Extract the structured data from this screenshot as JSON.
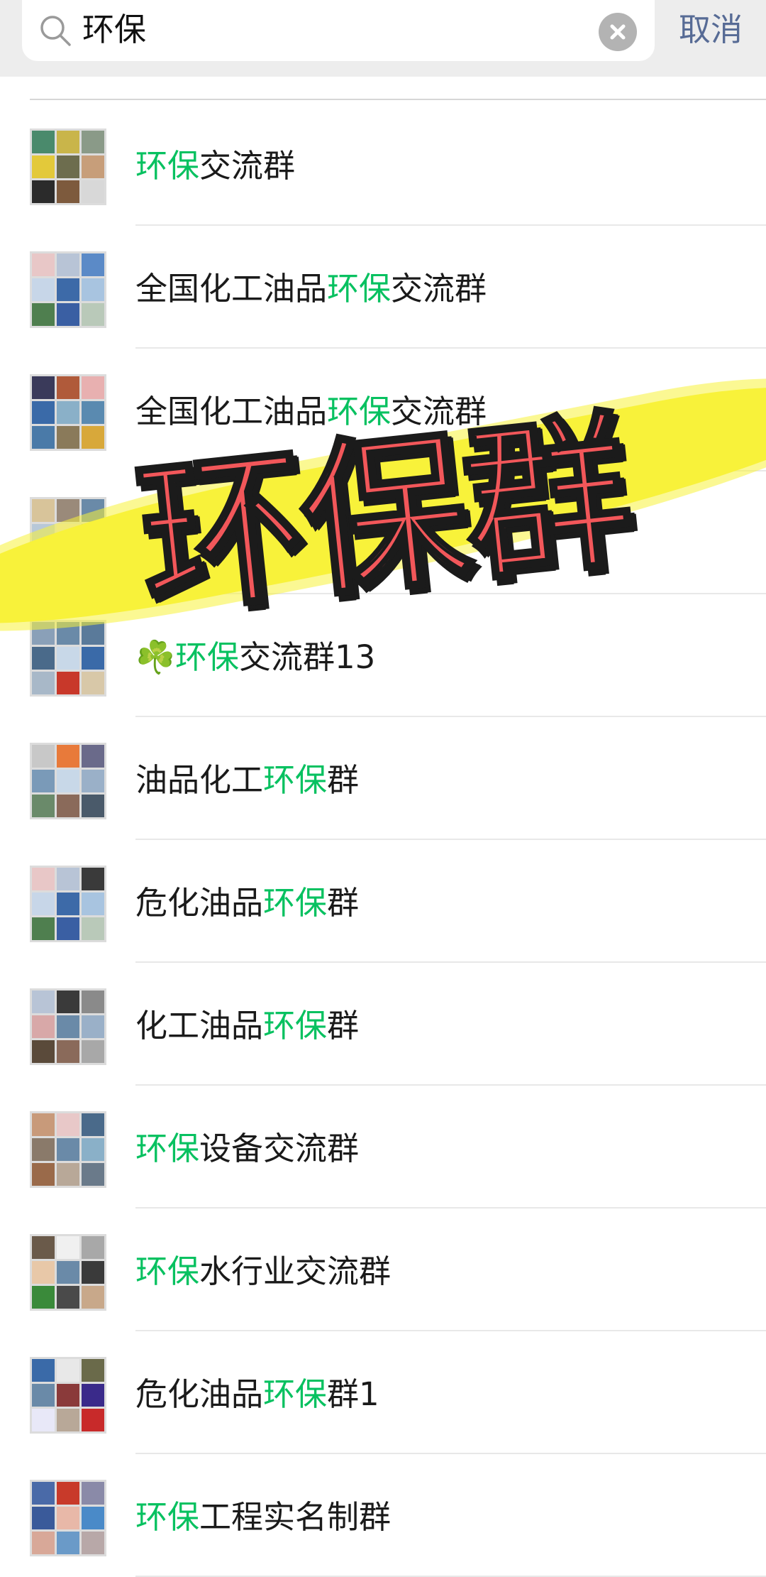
{
  "search": {
    "query": "环保",
    "cancel_label": "取消"
  },
  "results": [
    {
      "prefix": "",
      "highlight": "环保",
      "suffix": "交流群"
    },
    {
      "prefix": "全国化工油品",
      "highlight": "环保",
      "suffix": "交流群"
    },
    {
      "prefix": "全国化工油品",
      "highlight": "环保",
      "suffix": "交流群"
    },
    {
      "prefix": "",
      "highlight": "",
      "suffix": ""
    },
    {
      "prefix": "☘️",
      "highlight": "环保",
      "suffix": "交流群13"
    },
    {
      "prefix": "油品化工",
      "highlight": "环保",
      "suffix": "群"
    },
    {
      "prefix": "危化油品",
      "highlight": "环保",
      "suffix": "群"
    },
    {
      "prefix": "化工油品",
      "highlight": "环保",
      "suffix": "群"
    },
    {
      "prefix": "",
      "highlight": "环保",
      "suffix": "设备交流群"
    },
    {
      "prefix": "",
      "highlight": "环保",
      "suffix": "水行业交流群"
    },
    {
      "prefix": "危化油品",
      "highlight": "环保",
      "suffix": "群1"
    },
    {
      "prefix": "",
      "highlight": "环保",
      "suffix": "工程实名制群"
    }
  ],
  "overlay": {
    "title": "环保群"
  },
  "colors": {
    "highlight": "#07c160",
    "cancel": "#576b95",
    "overlay_text": "#f2575a",
    "overlay_stripe": "#f8f23a"
  }
}
